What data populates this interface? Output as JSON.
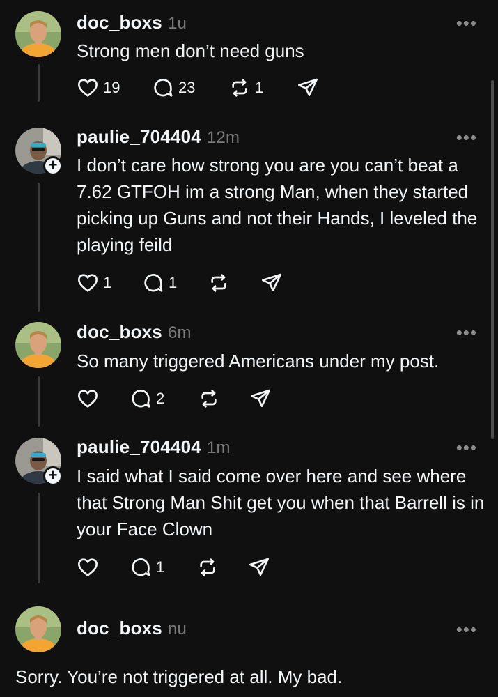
{
  "posts": [
    {
      "username": "doc_boxs",
      "time": "1u",
      "text": "Strong men don’t need guns",
      "likes": "19",
      "replies": "23",
      "reposts": "1"
    },
    {
      "username": "paulie_704404",
      "time": "12m",
      "text": "I don’t care how strong you are you can’t beat a 7.62 GTFOH im a strong Man, when they started picking up Guns and not their Hands, I leveled the playing feild",
      "likes": "1",
      "replies": "1",
      "reposts": ""
    },
    {
      "username": "doc_boxs",
      "time": "6m",
      "text": "So many triggered Americans under my post.",
      "likes": "",
      "replies": "2",
      "reposts": ""
    },
    {
      "username": "paulie_704404",
      "time": "1m",
      "text": "I said what I said come over here and see where that Strong Man Shit get you when that Barrell is in your Face Clown",
      "likes": "",
      "replies": "1",
      "reposts": ""
    },
    {
      "username": "doc_boxs",
      "time": "nu",
      "text": "Sorry. You’re not triggered at all. My bad."
    }
  ],
  "more_label": "•••",
  "plus_label": "+",
  "icons": [
    "heart-icon",
    "reply-icon",
    "repost-icon",
    "share-icon",
    "more-icon",
    "follow-plus-icon"
  ],
  "colors": {
    "background": "#101010",
    "text": "#f3f5f7",
    "muted": "#7a7a7a",
    "thread_line": "#3a3a3a"
  }
}
